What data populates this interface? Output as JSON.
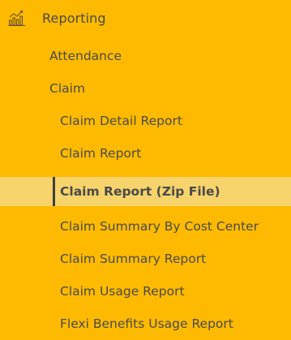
{
  "section": {
    "label": "Reporting",
    "icon": "bar-chart-icon"
  },
  "menu": {
    "attendance": "Attendance",
    "claim": "Claim",
    "claim_items": [
      "Claim Detail Report",
      "Claim Report",
      "Claim Report (Zip File)",
      "Claim Summary By Cost Center",
      "Claim Summary Report",
      "Claim Usage Report",
      "Flexi Benefits Usage Report"
    ],
    "active_item": "Claim Report (Zip File)"
  },
  "colors": {
    "background": "#FDBA00",
    "active_background": "#F6D36B",
    "active_indicator": "#3f3f3f",
    "text": "#4a4a4a"
  }
}
